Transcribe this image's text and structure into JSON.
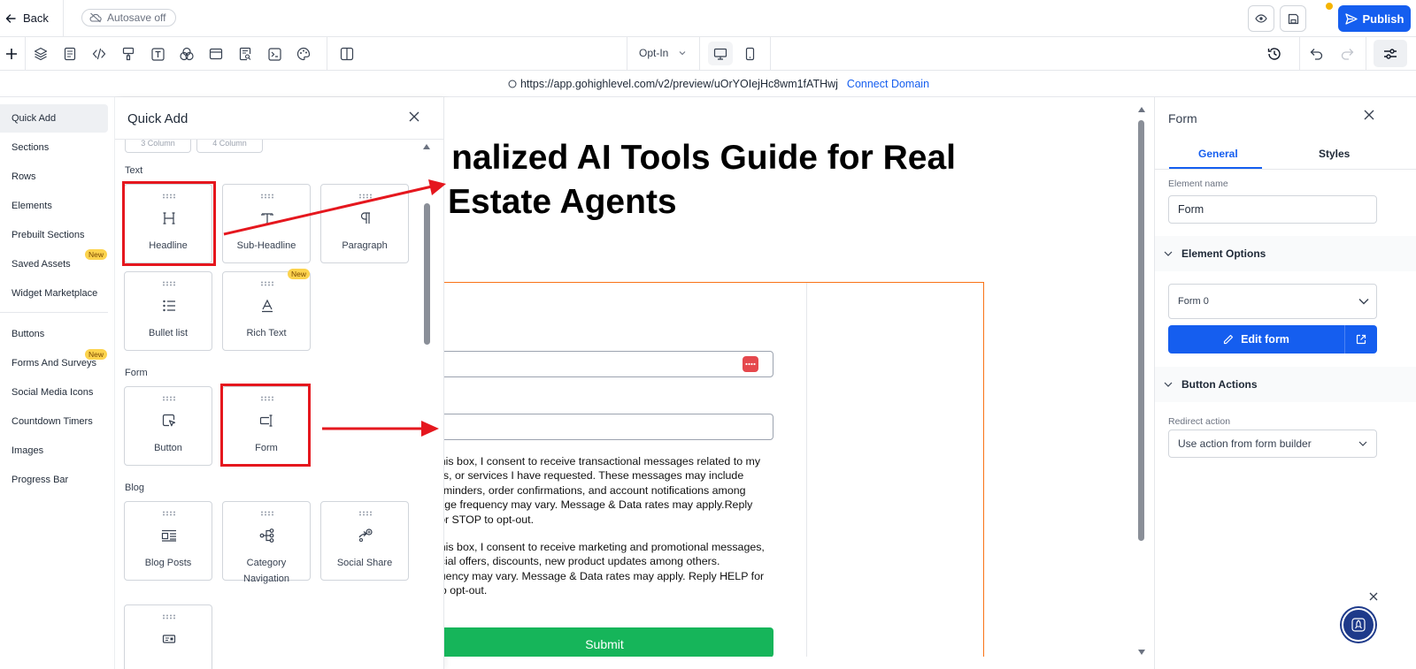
{
  "topbar": {
    "back_label": "Back",
    "autosave_label": "Autosave off",
    "publish_label": "Publish",
    "icons": [
      "arrow-left-icon",
      "cloud-off-icon",
      "eye-icon",
      "save-icon",
      "send-icon"
    ]
  },
  "toolbar": {
    "page_select": "Opt-In",
    "icons": [
      "plus-icon",
      "layers-icon",
      "page-icon",
      "code-icon",
      "paint-icon",
      "text-icon",
      "shapes-icon",
      "layout-icon",
      "search-page-icon",
      "terminal-icon",
      "palette-icon",
      "split-icon",
      "history-icon",
      "undo-icon",
      "redo-icon",
      "settings-sliders-icon"
    ]
  },
  "urlbar": {
    "url": "https://app.gohighlevel.com/v2/preview/uOrYOIejHc8wm1fATHwj",
    "connect_label": "Connect Domain"
  },
  "categories": {
    "items": [
      {
        "label": "Quick Add"
      },
      {
        "label": "Sections"
      },
      {
        "label": "Rows"
      },
      {
        "label": "Elements"
      },
      {
        "label": "Prebuilt Sections"
      },
      {
        "label": "Saved Assets"
      },
      {
        "label": "Widget Marketplace"
      },
      {
        "label": "Buttons"
      },
      {
        "label": "Forms And Surveys"
      },
      {
        "label": "Social Media Icons"
      },
      {
        "label": "Countdown Timers"
      },
      {
        "label": "Images"
      },
      {
        "label": "Progress Bar"
      }
    ],
    "new_badge": "New"
  },
  "quick_add": {
    "title": "Quick Add",
    "partial_labels": [
      "3 Column",
      "4 Column"
    ],
    "sections": {
      "text": "Text",
      "form": "Form",
      "blog": "Blog"
    },
    "cards": {
      "headline": "Headline",
      "sub_headline": "Sub-Headline",
      "paragraph": "Paragraph",
      "bullet_list": "Bullet list",
      "rich_text": "Rich Text",
      "button": "Button",
      "form": "Form",
      "blog_posts": "Blog Posts",
      "category_navigation": "Category Navigation",
      "social_share": "Social Share"
    },
    "new_badge": "New"
  },
  "canvas": {
    "headline_line1": "nalized AI Tools Guide for Real",
    "headline_line2": "Estate Agents",
    "consent1": [
      "g this box, I consent to receive transactional messages related to my",
      "ders, or services I have requested. These messages may include",
      "t reminders, order confirmations, and account notifications among",
      "ssage frequency may vary. Message & Data rates may apply.Reply",
      "lp or STOP to opt-out."
    ],
    "consent2": [
      "g this box, I consent to receive marketing and promotional messages,",
      "pecial offers, discounts, new product updates among others.",
      "equency may vary. Message & Data rates may apply. Reply HELP for",
      "P to opt-out."
    ],
    "submit_label": "Submit"
  },
  "right_panel": {
    "title": "Form",
    "tabs": [
      "General",
      "Styles"
    ],
    "element_name_label": "Element name",
    "element_name_value": "Form",
    "element_options_label": "Element Options",
    "form_select_value": "Form 0",
    "edit_form_label": "Edit form",
    "button_actions_label": "Button Actions",
    "redirect_label": "Redirect action",
    "redirect_value": "Use action from form builder"
  },
  "colors": {
    "primary": "#155eef",
    "highlight": "#e5171e",
    "submit": "#16b55a",
    "form_outline": "#f97316",
    "badge": "#fcd34d"
  }
}
